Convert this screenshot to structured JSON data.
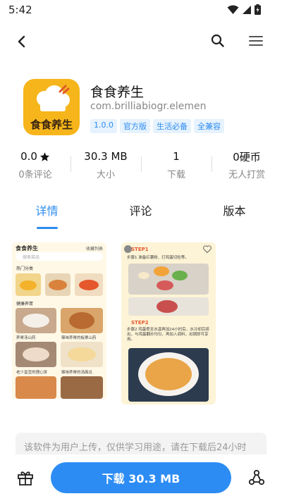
{
  "status_bar": {
    "time": "5:42"
  },
  "app": {
    "name": "食食养生",
    "package": "com.brilliabiogr.elemen",
    "icon_text": "食食养生",
    "tags": [
      "1.0.0",
      "官方版",
      "生活必备",
      "全兼容"
    ]
  },
  "stats": {
    "rating": {
      "value": "0.0",
      "label": "0条评论"
    },
    "size": {
      "value": "30.3 MB",
      "label": "大小"
    },
    "downloads": {
      "value": "1",
      "label": "下载"
    },
    "tips": {
      "value": "0硬币",
      "label": "无人打赏"
    }
  },
  "tabs": [
    "详情",
    "评论",
    "版本"
  ],
  "screenshots": {
    "shot1": {
      "brand": "食食养生",
      "fav": "收藏列表",
      "search_placeholder": "搜索菜品",
      "hot_label": "热门分类",
      "recipes_label": "健康养胃",
      "captions": [
        "养胃汤山药",
        "辣味养胃的板栗山药",
        "老少皆宜的理心饼",
        "辣味养胃的汤面瓜"
      ]
    },
    "shot2": {
      "step1_label": "STEP1",
      "step1_text": "步骤1 准备红薯粉、打鸡蛋切粒等。",
      "step2_label": "STEP2",
      "step2_text": "步骤2 鸡蛋煮至水温再加24小时后，水冷却后捞出，与鸡蛋翻炒均匀，再加入调料，出锅即可享用。"
    }
  },
  "notice": "该软件为用户上传，仅供学习用途，请在下载后24小时",
  "download_label": "下载 30.3 MB",
  "colors": {
    "accent": "#2c8cf4",
    "icon_bg": "#f5b51b"
  }
}
